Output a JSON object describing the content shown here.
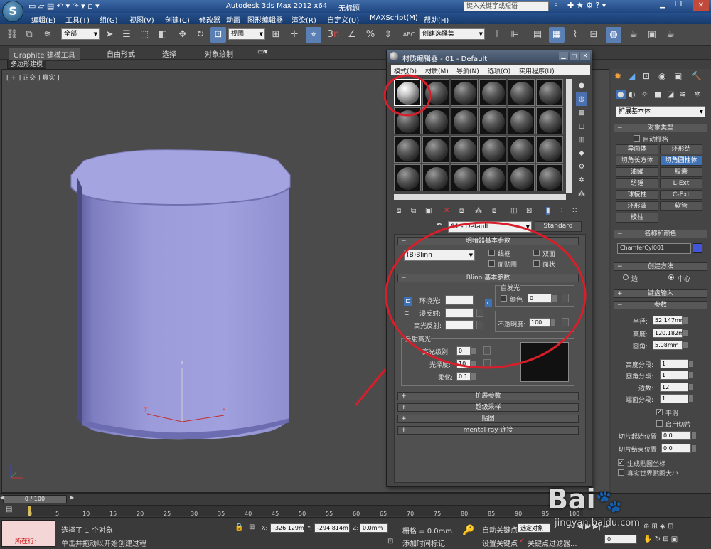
{
  "app": {
    "title_text": "Autodesk 3ds Max  2012 x64",
    "untitled": "无标题",
    "search_placeholder": "键入关键字或短语",
    "logo_letter": "S"
  },
  "menu": [
    "编辑(E)",
    "工具(T)",
    "组(G)",
    "视图(V)",
    "创建(C)",
    "修改器",
    "动画",
    "图形编辑器",
    "渲染(R)",
    "自定义(U)",
    "MAXScript(M)",
    "帮助(H)"
  ],
  "toolbar": {
    "filter_select": "全部",
    "coord_select": "视图",
    "selection_set": "创建选择集",
    "snap_3": "3",
    "snap_n": "n",
    "percent": "%",
    "abc": "ABC"
  },
  "ribbon": {
    "tabs": [
      "Graphite 建模工具",
      "自由形式",
      "选择",
      "对象绘制"
    ],
    "sub_tab": "多边形建模"
  },
  "viewport": {
    "label": "[ + ] 正交 ] 真实 ]",
    "axis_x": "x",
    "axis_y": "y",
    "axis_z": "z",
    "cylinder_color": "#9a9ad8"
  },
  "material_editor": {
    "title": "材质编辑器 - 01 - Default",
    "menus": [
      "模式(D)",
      "材质(M)",
      "导航(N)",
      "选项(O)",
      "实用程序(U)"
    ],
    "material_name": "01 - Default",
    "material_type": "Standard",
    "shader_rollout": "明暗器基本参数",
    "shader_type": "(B)Blinn",
    "wire": "线框",
    "two_sided": "双面",
    "face_map": "面贴图",
    "faceted": "面状",
    "blinn_rollout": "Blinn 基本参数",
    "self_illum": "自发光",
    "color_label": "颜色",
    "color_value": "0",
    "ambient": "环境光:",
    "diffuse": "漫反射:",
    "specular": "高光反射:",
    "opacity_label": "不透明度:",
    "opacity_value": "100",
    "spec_highlights": "反射高光",
    "spec_level": "高光级别:",
    "spec_level_value": "0",
    "glossiness": "光泽度:",
    "glossiness_value": "10",
    "soften": "柔化:",
    "soften_value": "0.1",
    "rollouts": [
      "扩展参数",
      "超级采样",
      "贴图",
      "mental ray 连接"
    ]
  },
  "command_panel": {
    "category": "扩展基本体",
    "object_type": "对象类型",
    "autogrid": "自动栅格",
    "object_buttons": [
      "异面体",
      "环形结",
      "切角长方体",
      "切角圆柱体",
      "油罐",
      "胶囊",
      "纺锤",
      "L-Ext",
      "球棱柱",
      "C-Ext",
      "环形波",
      "软管",
      "棱柱"
    ],
    "name_color": "名称和颜色",
    "object_name": "ChamferCyl001",
    "object_color": "#4455dd",
    "creation_method": "创建方法",
    "edge": "边",
    "center": "中心",
    "keyboard_entry": "键盘输入",
    "parameters": "参数",
    "params": [
      {
        "label": "半径:",
        "value": "52.147mm"
      },
      {
        "label": "高度:",
        "value": "120.182m"
      },
      {
        "label": "圆角:",
        "value": "5.08mm"
      }
    ],
    "segments": [
      {
        "label": "高度分段:",
        "value": "1"
      },
      {
        "label": "圆角分段:",
        "value": "1"
      },
      {
        "label": "边数:",
        "value": "12"
      },
      {
        "label": "端面分段:",
        "value": "1"
      }
    ],
    "smooth": "平滑",
    "slice_on": "启用切片",
    "slice_from": "切片起始位置:",
    "slice_from_value": "0.0",
    "slice_to": "切片结束位置:",
    "slice_to_value": "0.0",
    "gen_map": "生成贴图坐标",
    "real_world": "真实世界贴图大小"
  },
  "timeline": {
    "frame": "0 / 100",
    "ticks": [
      "0",
      "5",
      "10",
      "15",
      "20",
      "25",
      "30",
      "35",
      "40",
      "45",
      "50",
      "55",
      "60",
      "65",
      "70",
      "75",
      "80",
      "85",
      "90",
      "95",
      "100"
    ]
  },
  "status": {
    "selected": "选择了 1 个对象",
    "prompt": "单击并拖动以开始创建过程",
    "mode": "所在行:",
    "x_label": "X:",
    "x_value": "-326.129m",
    "y_label": "Y:",
    "y_value": "-294.814m",
    "z_label": "Z:",
    "z_value": "0.0mm",
    "grid": "栅格 = 0.0mm",
    "auto_key": "自动关键点",
    "set_key": "设置关键点",
    "selected_obj": "选定对象",
    "key_filters": "关键点过滤器...",
    "add_time_tag": "添加时间标记",
    "frame_value": "0"
  },
  "watermark": {
    "text": "Bai",
    "sub": "jingyan.baidu.com"
  }
}
